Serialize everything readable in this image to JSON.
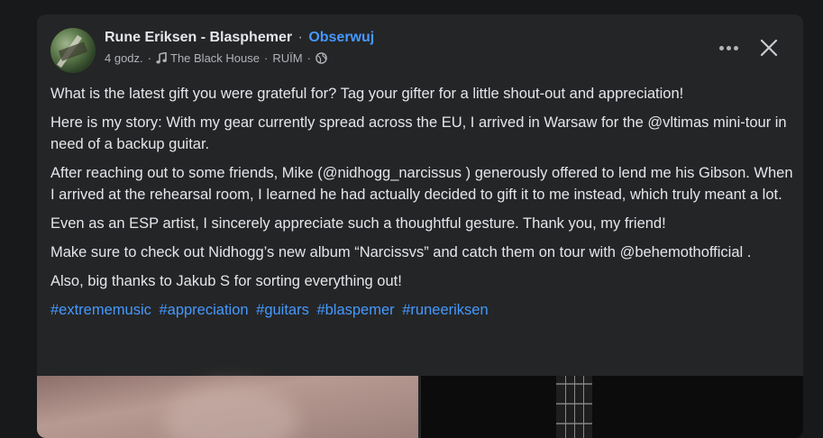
{
  "post": {
    "author": "Rune Eriksen - Blasphemer",
    "separator": "·",
    "follow_label": "Obserwuj",
    "time": "4 godz.",
    "location": "The Black House",
    "audience_label": "RUÏM",
    "paragraphs": [
      "What is the latest gift you were grateful for? Tag your gifter for a little shout-out and appreciation!",
      "Here is my story: With my gear currently spread across the EU, I arrived in Warsaw for the @vltimas mini-tour in need of a backup guitar.",
      "After reaching out to some friends, Mike (@nidhogg_narcissus ) generously offered to lend me his Gibson. When I arrived at the rehearsal room, I learned he had actually decided to gift it to me instead, which truly meant a lot.",
      "Even as an ESP artist, I sincerely appreciate such a thoughtful gesture. Thank you, my friend!",
      "Make sure to check out Nidhogg’s new album “Narcissvs” and catch them on tour with @behemothofficial .",
      "Also, big thanks to Jakub S for sorting everything out!"
    ],
    "hashtags": [
      "#extrememusic",
      "#appreciation",
      "#guitars",
      "#blaspemer",
      "#runeeriksen"
    ]
  },
  "icons": {
    "more": "more-horizontal-icon",
    "close": "close-icon",
    "music_note": "music-note-icon",
    "globe": "globe-icon"
  },
  "colors": {
    "background": "#18191a",
    "card": "#242526",
    "text": "#e4e6eb",
    "secondary_text": "#b0b3b8",
    "link": "#4599ff"
  }
}
